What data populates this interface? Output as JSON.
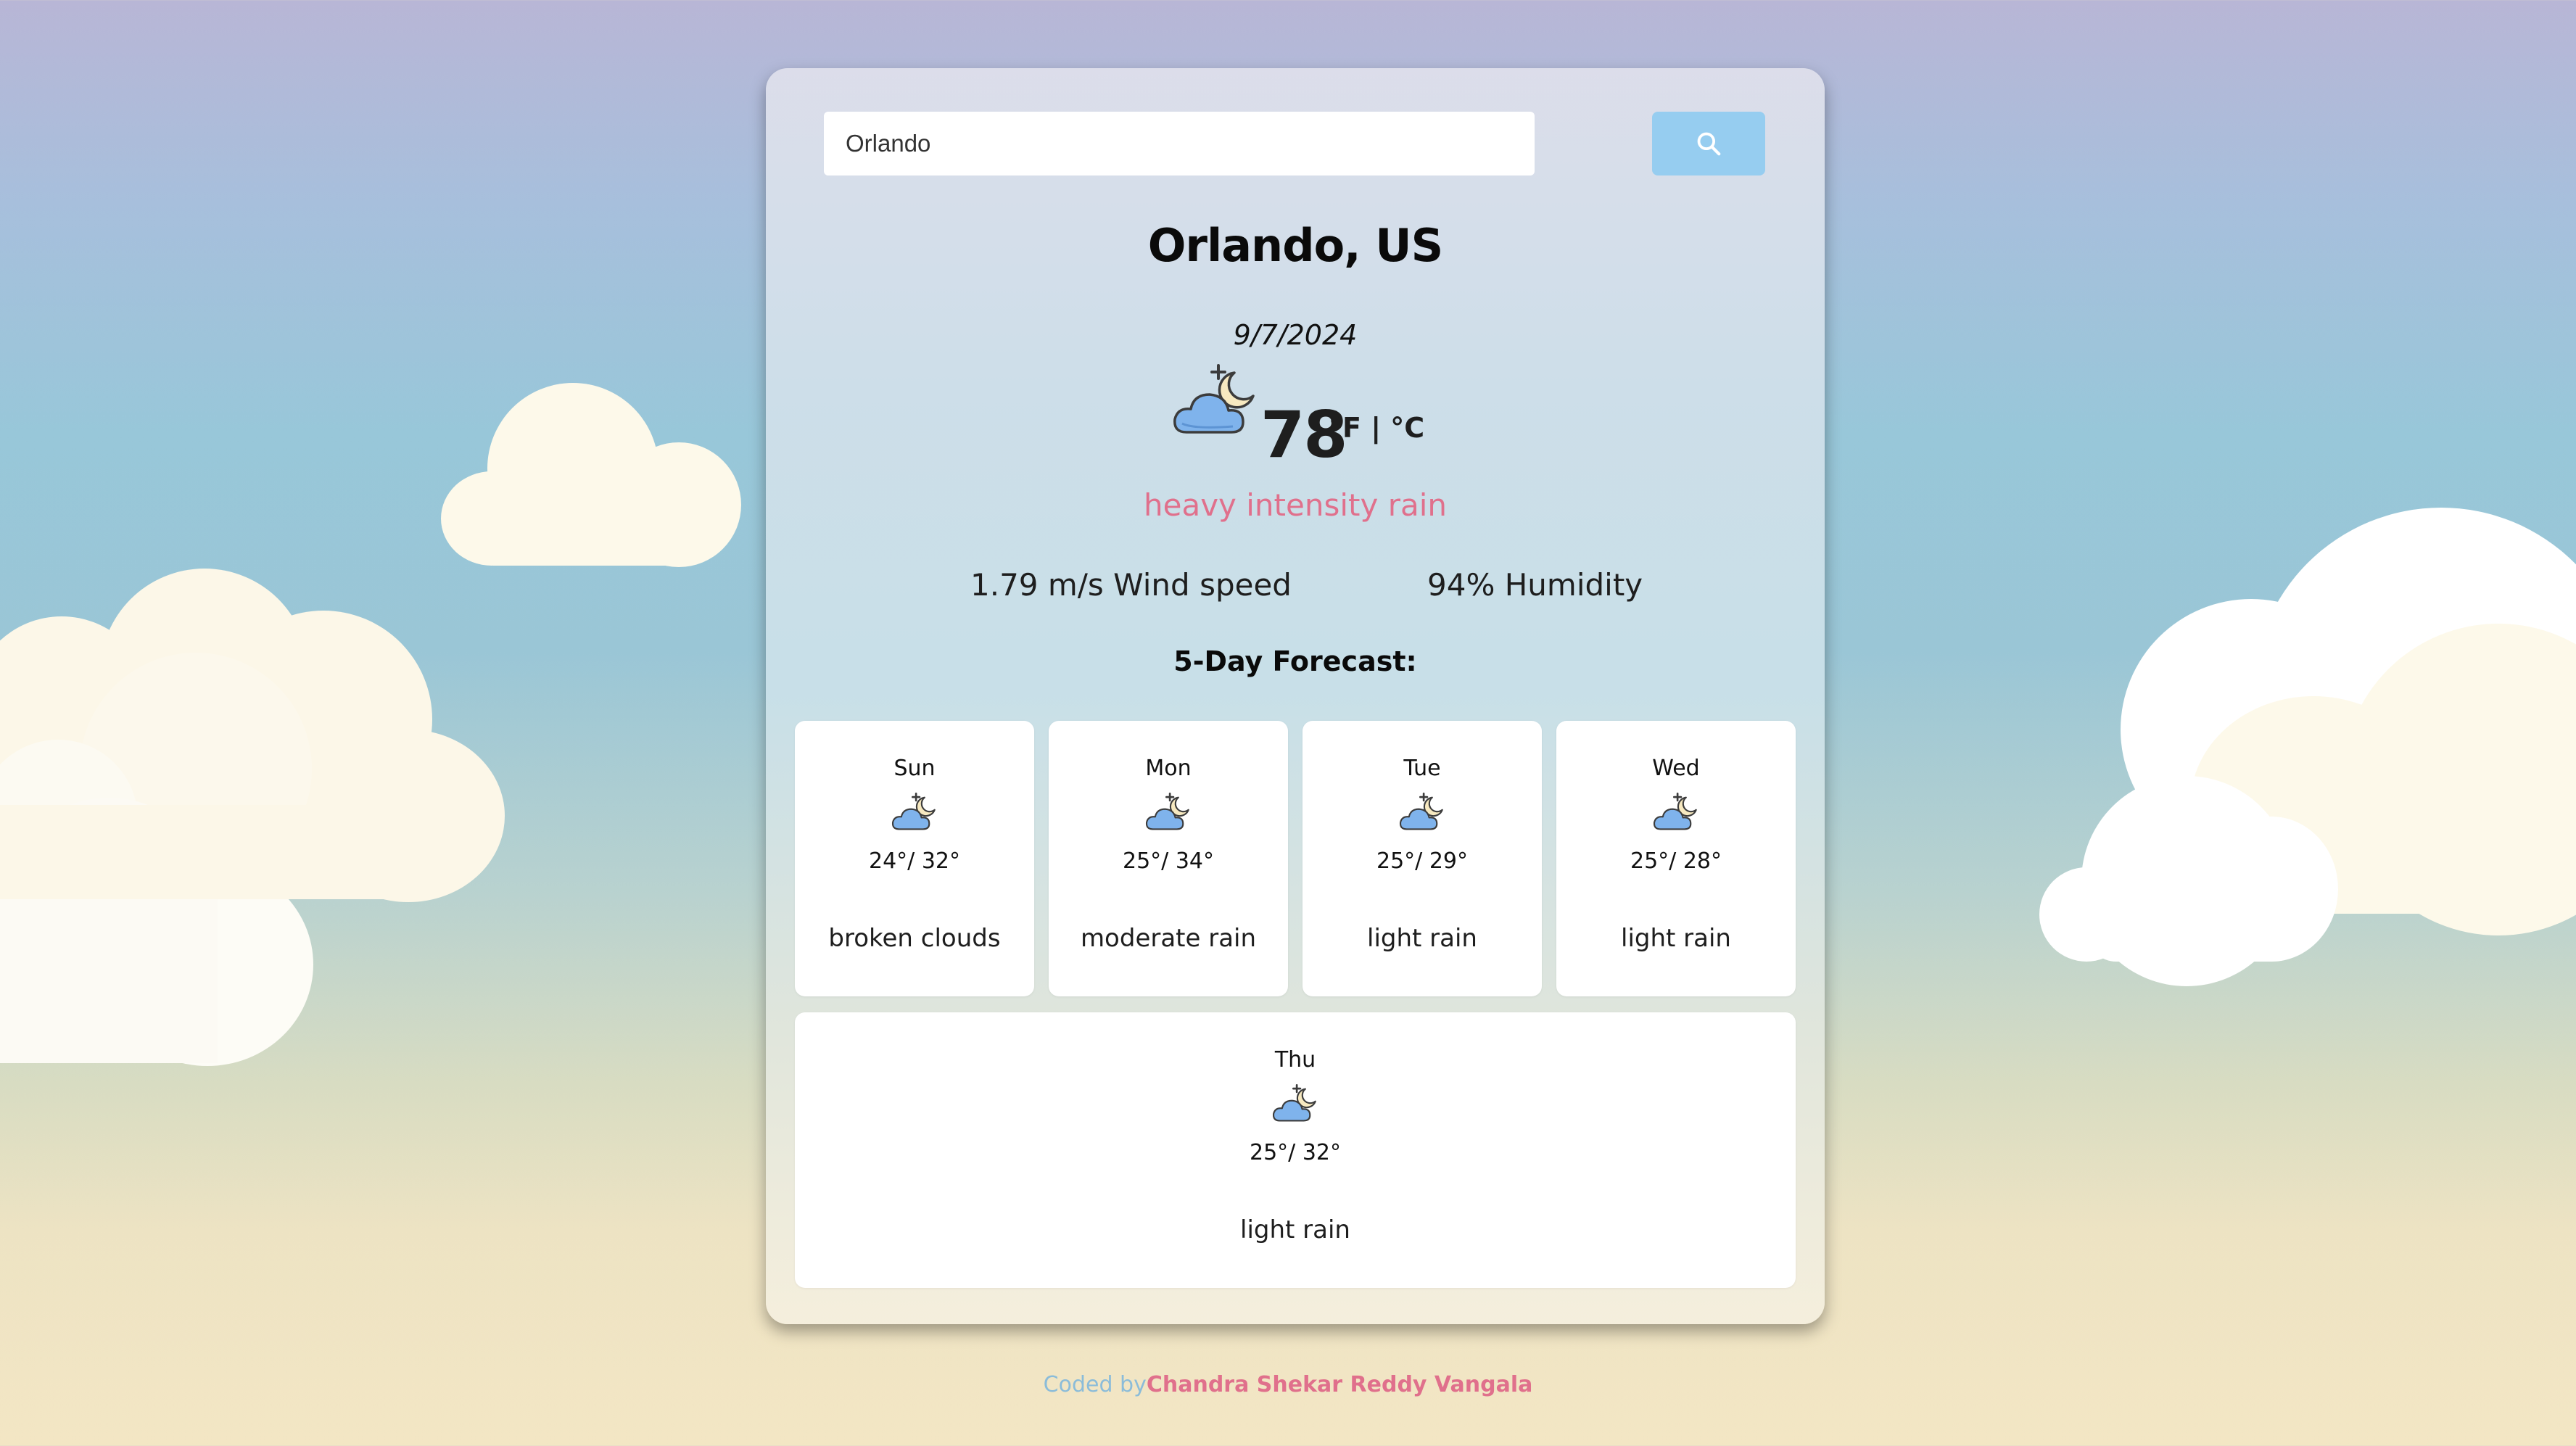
{
  "search": {
    "value": "Orlando",
    "button_icon": "search-icon"
  },
  "weather": {
    "city": "Orlando, US",
    "date": "9/7/2024",
    "icon": "cloud-moon-icon",
    "temperature": "78",
    "units": "°F | °C",
    "description": "heavy intensity rain",
    "wind": "1.79 m/s Wind speed",
    "humidity": "94% Humidity"
  },
  "forecast": {
    "title": "5-Day Forecast:",
    "days": [
      {
        "day": "Sun",
        "icon": "cloud-moon-icon",
        "range": "24°/ 32°",
        "description": "broken clouds"
      },
      {
        "day": "Mon",
        "icon": "cloud-moon-icon",
        "range": "25°/ 34°",
        "description": "moderate rain"
      },
      {
        "day": "Tue",
        "icon": "cloud-moon-icon",
        "range": "25°/ 29°",
        "description": "light rain"
      },
      {
        "day": "Wed",
        "icon": "cloud-moon-icon",
        "range": "25°/ 28°",
        "description": "light rain"
      },
      {
        "day": "Thu",
        "icon": "cloud-moon-icon",
        "range": "25°/ 32°",
        "description": "light rain"
      }
    ]
  },
  "footer": {
    "prefix": "Coded by",
    "author": "Chandra Shekar Reddy Vangala"
  },
  "colors": {
    "accent_pink": "#e0708c",
    "button_blue": "#96cdf0",
    "cloud_cream": "#fffbec"
  }
}
